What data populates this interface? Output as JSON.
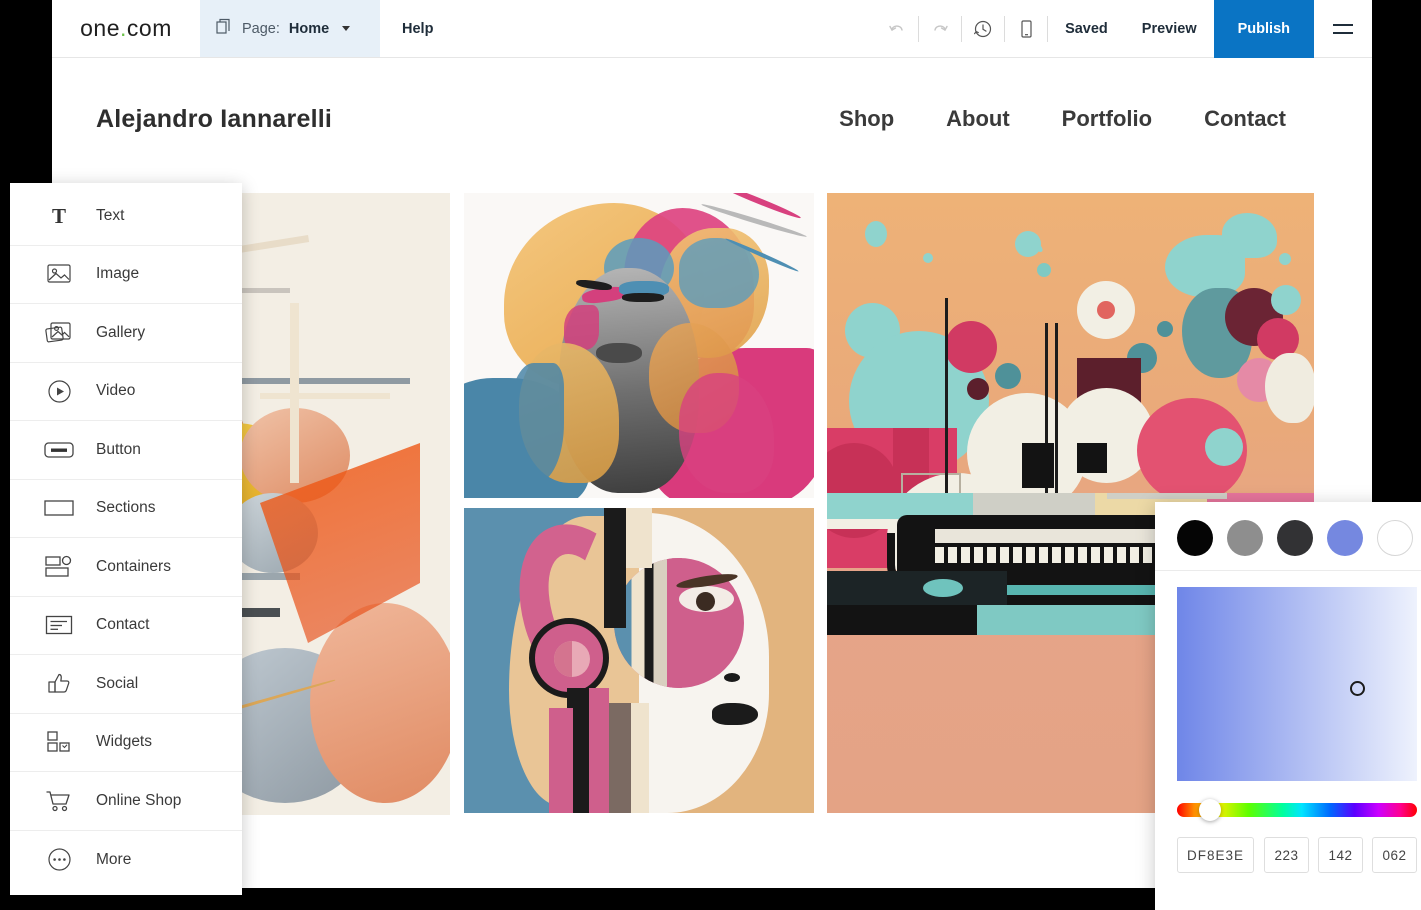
{
  "toolbar": {
    "brand": "one",
    "brand_dot": ".",
    "brand_suffix": "com",
    "pages_icon": "pages-icon",
    "page_label": "Page:",
    "page_value": "Home",
    "page_caret_icon": "chevron-down-icon",
    "help": "Help",
    "undo_icon": "undo-icon",
    "redo_icon": "redo-icon",
    "history_icon": "history-clock-icon",
    "mobile_icon": "mobile-preview-icon",
    "saved": "Saved",
    "preview": "Preview",
    "publish": "Publish",
    "menu_icon": "hamburger-menu-icon",
    "publish_color": "#0a74c4",
    "page_select_bg": "#e7f0f8"
  },
  "site": {
    "title": "Alejandro Iannarelli",
    "nav": [
      {
        "label": "Shop"
      },
      {
        "label": "About"
      },
      {
        "label": "Portfolio"
      },
      {
        "label": "Contact"
      }
    ],
    "gallery": [
      {
        "name": "abstract-spheres-artwork"
      },
      {
        "name": "splash-portrait-artwork"
      },
      {
        "name": "headphone-profile-artwork"
      },
      {
        "name": "typewriter-collage-artwork"
      }
    ]
  },
  "element_menu": {
    "items": [
      {
        "label": "Text",
        "icon": "text-icon"
      },
      {
        "label": "Image",
        "icon": "image-icon"
      },
      {
        "label": "Gallery",
        "icon": "gallery-icon"
      },
      {
        "label": "Video",
        "icon": "video-play-icon"
      },
      {
        "label": "Button",
        "icon": "button-icon"
      },
      {
        "label": "Sections",
        "icon": "sections-icon"
      },
      {
        "label": "Containers",
        "icon": "containers-icon"
      },
      {
        "label": "Contact",
        "icon": "contact-form-icon"
      },
      {
        "label": "Social",
        "icon": "thumbs-up-icon"
      },
      {
        "label": "Widgets",
        "icon": "widgets-icon"
      },
      {
        "label": "Online Shop",
        "icon": "shopping-cart-icon"
      },
      {
        "label": "More",
        "icon": "more-dots-icon"
      }
    ]
  },
  "color_picker": {
    "swatches": [
      {
        "name": "swatch-black",
        "color": "#050505",
        "selected": false
      },
      {
        "name": "swatch-gray",
        "color": "#8e8e8e",
        "selected": false
      },
      {
        "name": "swatch-dark-gray",
        "color": "#323234",
        "selected": false
      },
      {
        "name": "swatch-periwinkle",
        "color": "#7588e0",
        "selected": true
      },
      {
        "name": "swatch-white",
        "color": "#ffffff",
        "selected": false
      }
    ],
    "hex": "DF8E3E",
    "rgb": {
      "r": "223",
      "g": "142",
      "b": "062"
    }
  }
}
